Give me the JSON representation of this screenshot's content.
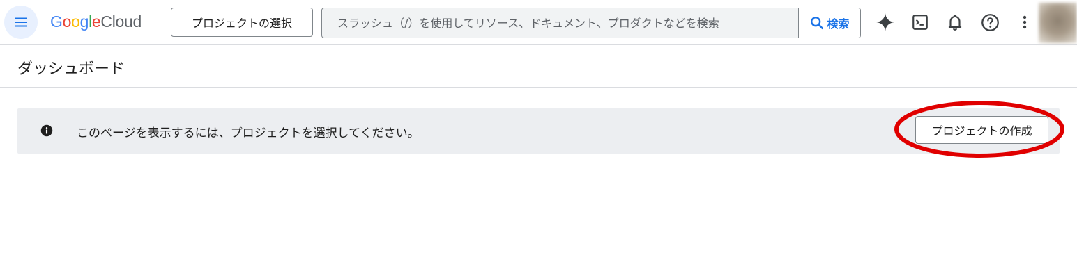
{
  "header": {
    "logo": {
      "google_letters": [
        "G",
        "o",
        "o",
        "g",
        "l",
        "e"
      ],
      "cloud": "Cloud"
    },
    "project_selector_label": "プロジェクトの選択",
    "search": {
      "placeholder": "スラッシュ（/）を使用してリソース、ドキュメント、プロダクトなどを検索",
      "button_label": "検索"
    },
    "icons": [
      "menu-icon",
      "gemini-icon",
      "cloud-shell-icon",
      "notifications-icon",
      "help-icon",
      "more-vert-icon"
    ]
  },
  "page": {
    "title": "ダッシュボード"
  },
  "banner": {
    "message": "このページを表示するには、プロジェクトを選択してください。",
    "create_button_label": "プロジェクトの作成"
  },
  "colors": {
    "google_blue": "#4285F4",
    "google_red": "#EA4335",
    "google_yellow": "#FBBC05",
    "google_green": "#34A853",
    "link_blue": "#1a73e8",
    "banner_bg": "#eceef1",
    "annotation_red": "#e00000"
  }
}
